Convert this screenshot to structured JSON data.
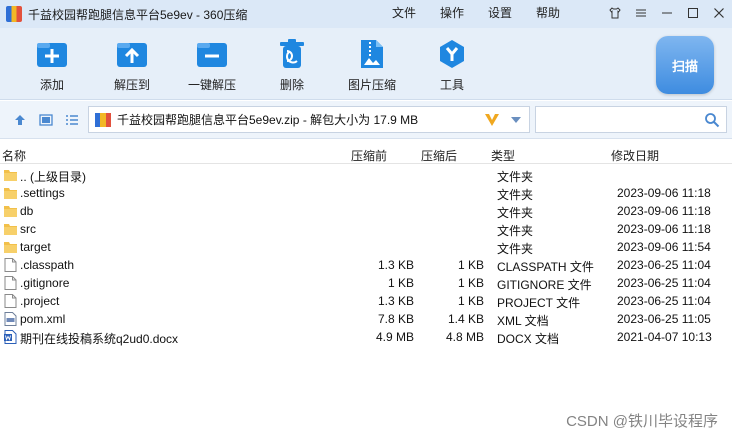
{
  "window": {
    "title": "千益校园帮跑腿信息平台5e9ev - 360压缩"
  },
  "menu": [
    "文件",
    "操作",
    "设置",
    "帮助"
  ],
  "toolbar": {
    "buttons": [
      {
        "label": "添加",
        "icon": "add-icon"
      },
      {
        "label": "解压到",
        "icon": "extract-to-icon"
      },
      {
        "label": "一键解压",
        "icon": "one-click-extract-icon"
      },
      {
        "label": "删除",
        "icon": "delete-icon"
      },
      {
        "label": "图片压缩",
        "icon": "image-compress-icon"
      },
      {
        "label": "工具",
        "icon": "tools-icon"
      }
    ],
    "scan_label": "扫描"
  },
  "address": {
    "path": "千益校园帮跑腿信息平台5e9ev.zip - 解包大小为 17.9 MB",
    "search_placeholder": ""
  },
  "columns": [
    "名称",
    "压缩前",
    "压缩后",
    "类型",
    "修改日期"
  ],
  "files": [
    {
      "name": ".. (上级目录)",
      "compressed": "",
      "uncompressed": "",
      "type": "文件夹",
      "date": "",
      "icon": "folder-icon"
    },
    {
      "name": ".settings",
      "compressed": "",
      "uncompressed": "",
      "type": "文件夹",
      "date": "2023-09-06 11:18",
      "icon": "folder-icon"
    },
    {
      "name": "db",
      "compressed": "",
      "uncompressed": "",
      "type": "文件夹",
      "date": "2023-09-06 11:18",
      "icon": "folder-icon"
    },
    {
      "name": "src",
      "compressed": "",
      "uncompressed": "",
      "type": "文件夹",
      "date": "2023-09-06 11:18",
      "icon": "folder-icon"
    },
    {
      "name": "target",
      "compressed": "",
      "uncompressed": "",
      "type": "文件夹",
      "date": "2023-09-06 11:54",
      "icon": "folder-icon"
    },
    {
      "name": ".classpath",
      "compressed": "1.3 KB",
      "uncompressed": "1 KB",
      "type": "CLASSPATH 文件",
      "date": "2023-06-25 11:04",
      "icon": "file-icon"
    },
    {
      "name": ".gitignore",
      "compressed": "1 KB",
      "uncompressed": "1 KB",
      "type": "GITIGNORE 文件",
      "date": "2023-06-25 11:04",
      "icon": "file-icon"
    },
    {
      "name": ".project",
      "compressed": "1.3 KB",
      "uncompressed": "1 KB",
      "type": "PROJECT 文件",
      "date": "2023-06-25 11:04",
      "icon": "file-icon"
    },
    {
      "name": "pom.xml",
      "compressed": "7.8 KB",
      "uncompressed": "1.4 KB",
      "type": "XML 文档",
      "date": "2023-06-25 11:05",
      "icon": "xml-file-icon"
    },
    {
      "name": "期刊在线投稿系统q2ud0.docx",
      "compressed": "4.9 MB",
      "uncompressed": "4.8 MB",
      "type": "DOCX 文档",
      "date": "2021-04-07 10:13",
      "icon": "docx-file-icon"
    }
  ],
  "watermark": "CSDN @铁川毕设程序"
}
